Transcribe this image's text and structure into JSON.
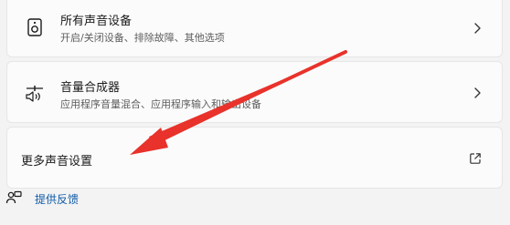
{
  "settings_list": {
    "items": [
      {
        "title": "所有声音设备",
        "subtitle": "开启/关闭设备、排除故障、其他选项",
        "icon": "speaker-device-icon"
      },
      {
        "title": "音量合成器",
        "subtitle": "应用程序音量混合、应用程序输入和输出设备",
        "icon": "volume-mixer-icon"
      }
    ],
    "more_settings": {
      "title": "更多声音设置",
      "icon": "external-link-icon"
    }
  },
  "feedback": {
    "label": "提供反馈",
    "icon": "feedback-icon"
  },
  "annotation": {
    "arrow_color": "#e8322b"
  },
  "colors": {
    "background": "#f3f3f3",
    "card": "#fbfbfb",
    "link": "#0e5aa7"
  }
}
